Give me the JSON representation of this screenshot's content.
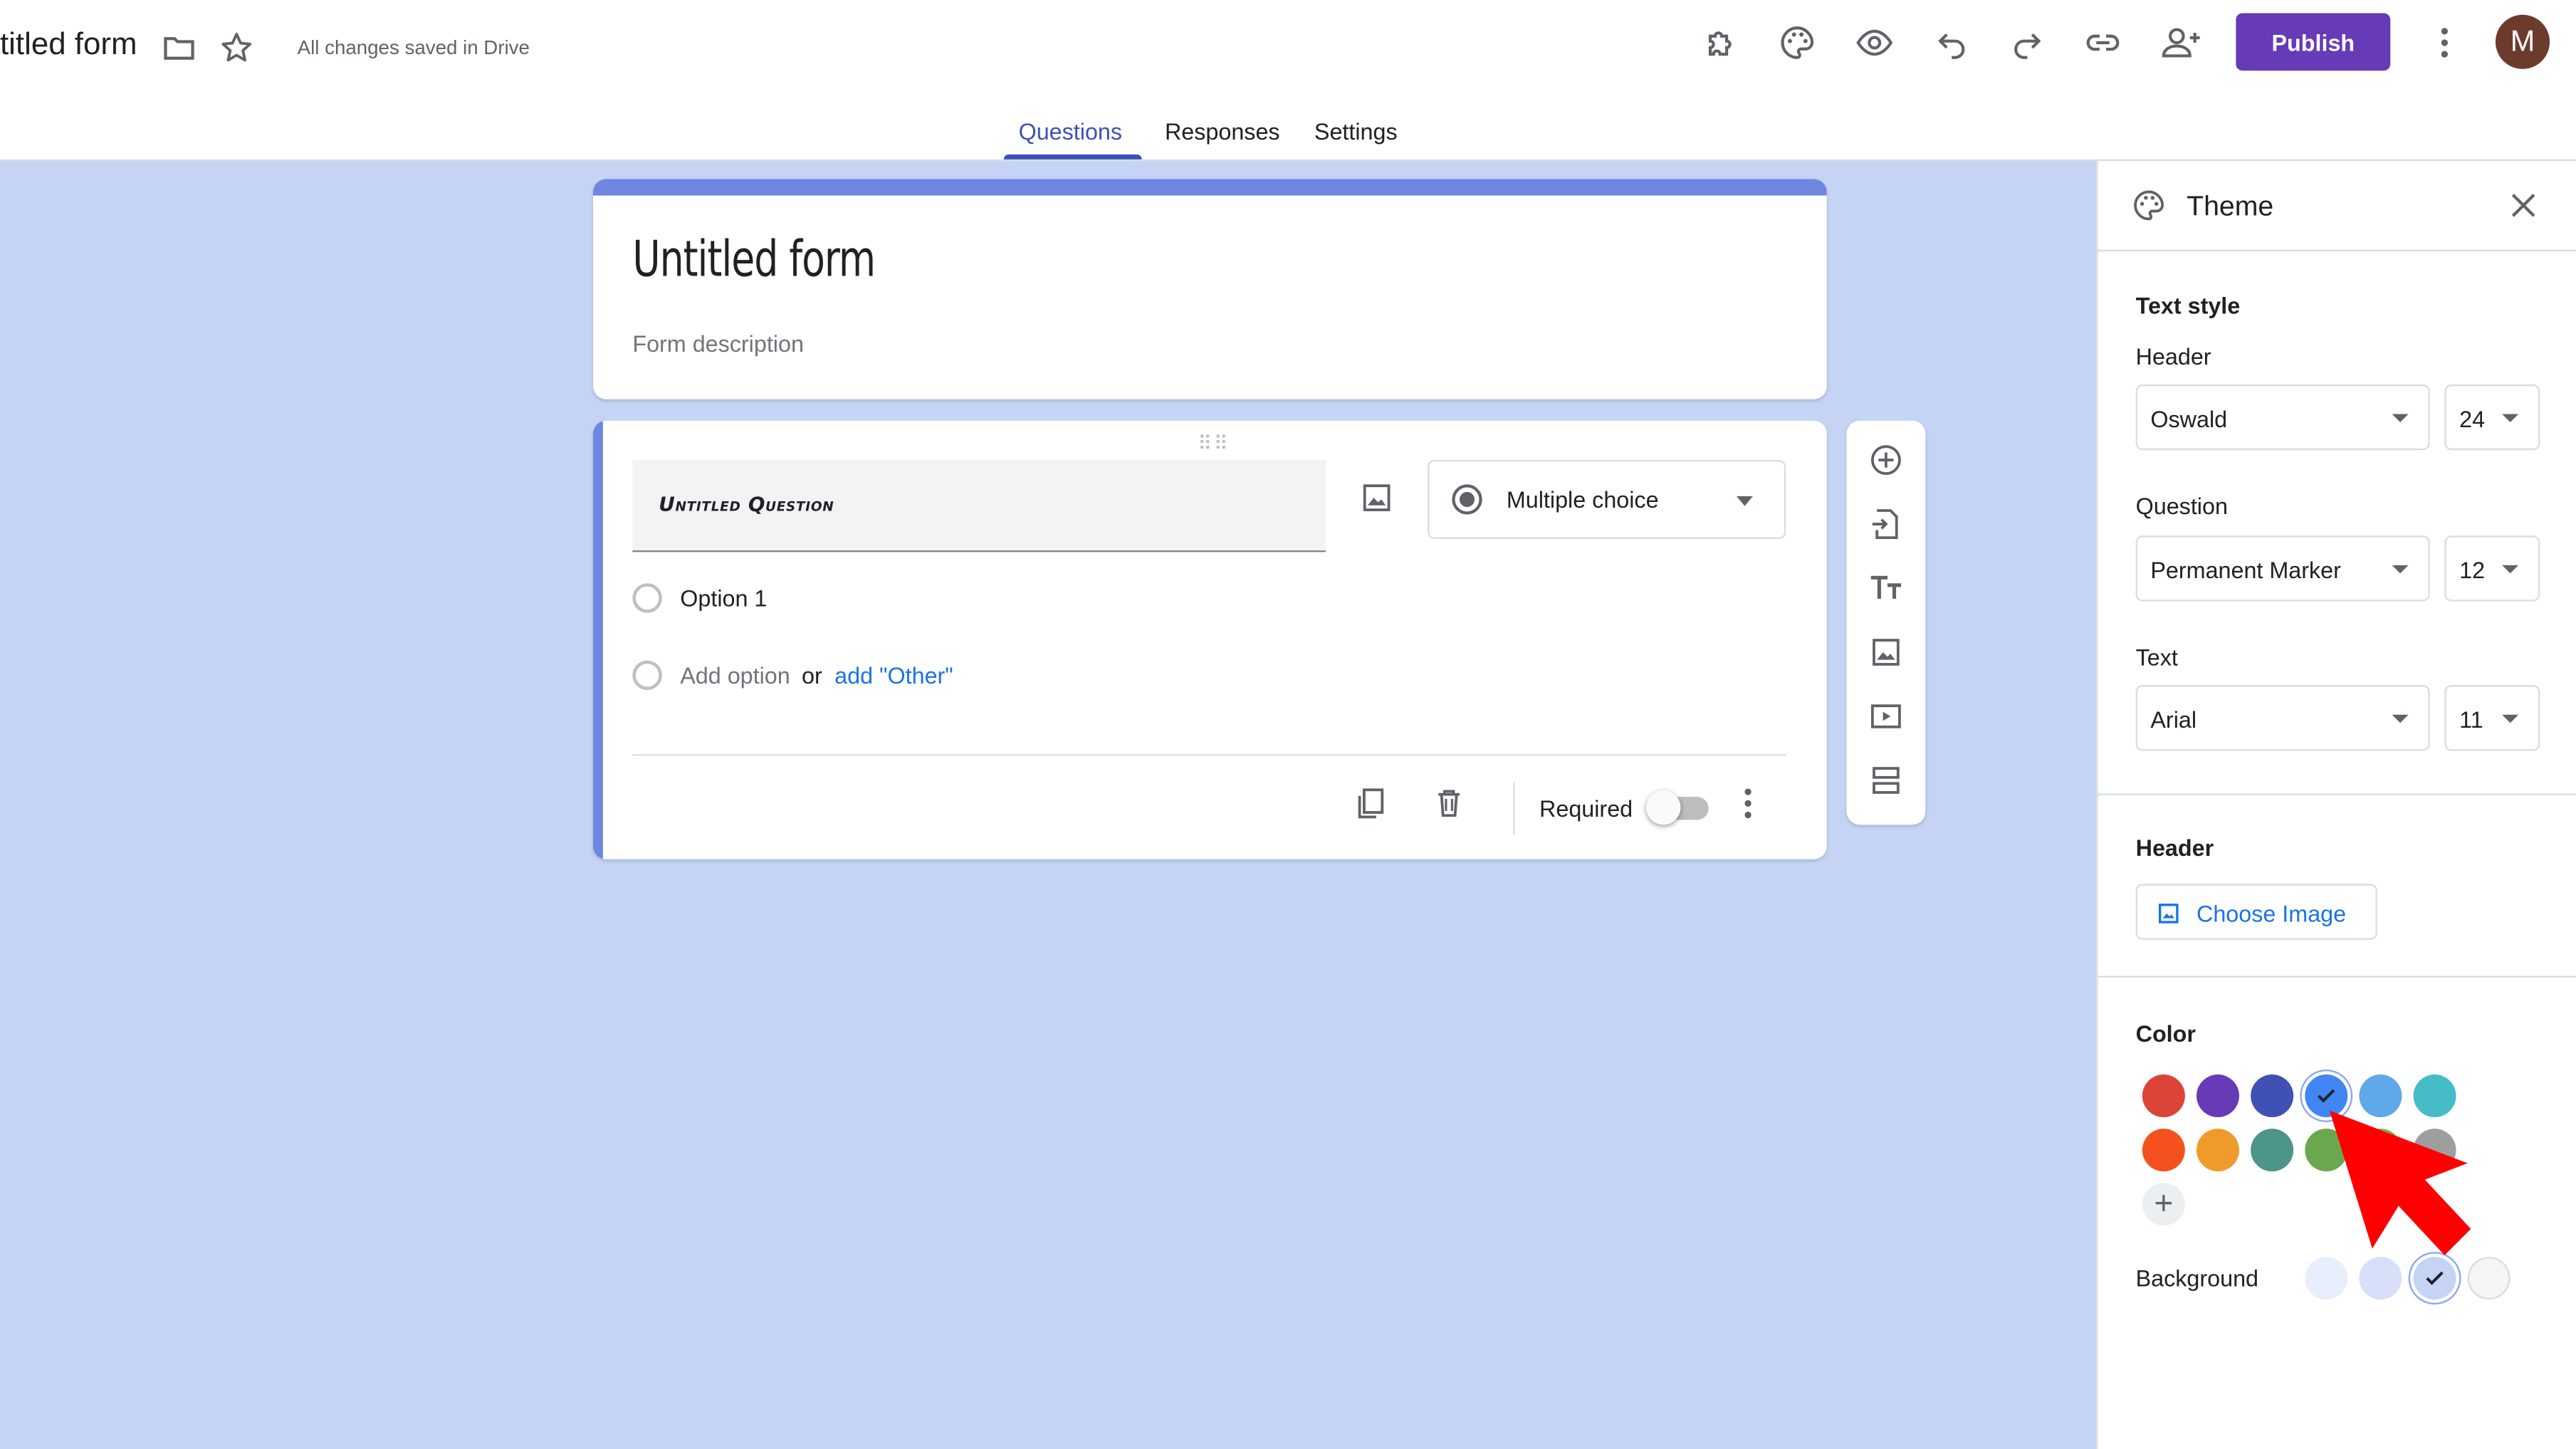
{
  "window": {
    "doc_title": "titled form",
    "saved_status": "All changes saved in Drive"
  },
  "toolbar": {
    "publish_label": "Publish",
    "avatar_letter": "M"
  },
  "tabs": [
    {
      "label": "Questions"
    },
    {
      "label": "Responses"
    },
    {
      "label": "Settings"
    }
  ],
  "form": {
    "title": "Untitled form",
    "description_placeholder": "Form description"
  },
  "question": {
    "title": "Untitled Question",
    "type": "Multiple choice",
    "option_1": "Option 1",
    "add_option": "Add option",
    "or": "or",
    "add_other": "add \"Other\"",
    "required_label": "Required",
    "required_on": false
  },
  "theme_panel": {
    "title": "Theme",
    "text_style_heading": "Text style",
    "header_label": "Header",
    "header_font": "Oswald",
    "header_size": "24",
    "question_label": "Question",
    "question_font": "Permanent Marker",
    "question_size": "12",
    "text_label": "Text",
    "text_font": "Arial",
    "text_size": "11",
    "header_section": "Header",
    "choose_image": "Choose Image",
    "color_heading": "Color",
    "background_label": "Background",
    "colors": [
      "#db4437",
      "#673ab7",
      "#3f51b5",
      "#4285f4",
      "#5fa8e9",
      "#46bdc6",
      "#f4511e",
      "#ee9b2c",
      "#4b9689",
      "#6aa84f",
      "#7cb342",
      "#9e9e9e"
    ],
    "selected_color": "#4285f4",
    "backgrounds": [
      "#e8edfb",
      "#d7e0f8",
      "#c5d4f4",
      "#f5f5f5"
    ],
    "selected_background": "#c5d4f4"
  },
  "colors": {
    "accent": "#673ab7",
    "form_accent": "#6d86e0",
    "canvas_bg": "#c5d4f4",
    "link": "#1a73e8"
  }
}
